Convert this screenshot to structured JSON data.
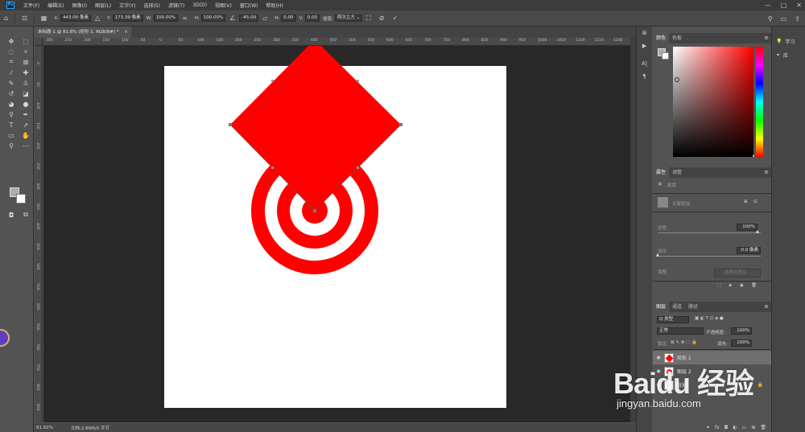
{
  "app": {
    "logo_text": "Ps",
    "menu": [
      "文件(F)",
      "编辑(E)",
      "图像(I)",
      "图层(L)",
      "文字(Y)",
      "选择(S)",
      "滤镜(T)",
      "3D(D)",
      "视图(V)",
      "窗口(W)",
      "帮助(H)"
    ],
    "window_controls": [
      "—",
      "□",
      "✕"
    ]
  },
  "options": {
    "x_label": "X:",
    "x_value": "443.00 像素",
    "y_label": "Y:",
    "y_value": "173.39 像素",
    "w_label": "W:",
    "w_value": "100.00%",
    "h_label": "H:",
    "h_value": "100.00%",
    "angle_value": "-45.00",
    "hskew_label": "H:",
    "hskew_value": "0.00",
    "vskew_label": "V:",
    "vskew_value": "0.00",
    "interp_label": "插值:",
    "interp_value": "两次立方 ⌄"
  },
  "document": {
    "tab_title": "未标题-1 @ 81.8% (矩形 1, RGB/8#) *",
    "tab_close": "×",
    "ruler_top": [
      "300",
      "250",
      "200",
      "150",
      "100",
      "50",
      "0",
      "50",
      "100",
      "150",
      "200",
      "250",
      "300",
      "350",
      "400",
      "450",
      "500",
      "550",
      "600",
      "650",
      "700",
      "750",
      "800",
      "850",
      "900",
      "950",
      "1000",
      "1050",
      "1100",
      "1150",
      "1200"
    ],
    "ruler_left": [
      "0",
      "50",
      "100",
      "150",
      "200",
      "250",
      "300",
      "350",
      "400",
      "450",
      "500",
      "550",
      "600",
      "650",
      "700",
      "750",
      "800",
      "850",
      "900"
    ],
    "zoom": "81.82%",
    "doc_info": "文档:2.86M/0 字节",
    "shape_color": "#ff0000"
  },
  "panels": {
    "color_tabs": [
      "颜色",
      "色板"
    ],
    "props_tabs": [
      "属性",
      "调整"
    ],
    "props_type": "蒙版",
    "props_no_selection": "无蒙版选",
    "density_label": "浓度:",
    "density_value": "100%",
    "feather_label": "羽化:",
    "feather_value": "0.0 像素",
    "adjust_label": "调整:",
    "select_mask_btn": "选择并遮住...",
    "layers_tabs": [
      "图层",
      "通道",
      "路径"
    ],
    "layers_search": "Q 类型",
    "blend_mode": "正常",
    "opacity_label": "不透明度:",
    "opacity_value": "100%",
    "lock_label": "锁定:",
    "fill_label": "填充:",
    "fill_value": "100%",
    "layers": [
      {
        "name": "矩形 1",
        "selected": true
      },
      {
        "name": "图层 2",
        "selected": false
      },
      {
        "name": "背景",
        "selected": false
      }
    ]
  },
  "dock2": [
    {
      "icon": "💡",
      "label": "学习"
    },
    {
      "icon": "⚭",
      "label": "库"
    }
  ],
  "watermark": {
    "text": "Baidu 经验",
    "url": "jingyan.baidu.com"
  }
}
